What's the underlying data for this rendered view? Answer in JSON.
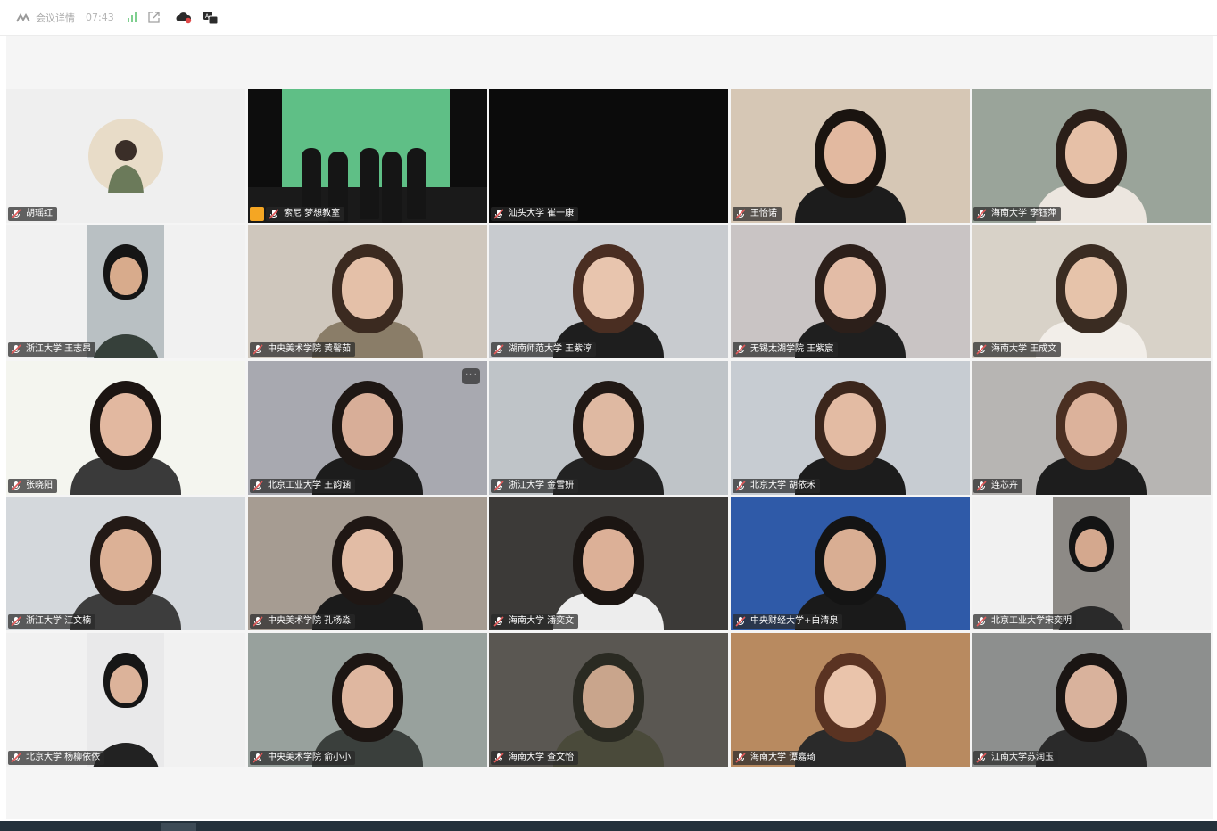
{
  "toolbar": {
    "meeting_details_label": "会议详情",
    "elapsed_time": "07:43",
    "icons": [
      "meeting-logo-icon",
      "signal-bars-icon",
      "external-link-icon",
      "cloud-record-icon",
      "translate-icon"
    ]
  },
  "colors": {
    "name_tag_bg": "#282828",
    "host_badge": "#f5a623",
    "mic_muted": "#e05a5a"
  },
  "participants": [
    {
      "name": "胡瑶红",
      "bg": "#efefef",
      "kind": "avatar"
    },
    {
      "name": "索尼 梦想教室",
      "bg": "#0d0d0d",
      "kind": "stage",
      "host": true
    },
    {
      "name": "汕头大学 崔一康",
      "bg": "#0b0b0b",
      "kind": "dark"
    },
    {
      "name": "王怡诺",
      "bg": "#d6c7b5",
      "kind": "video",
      "hair": "#1a1410",
      "shirt": "#1c1c1c",
      "skin": "#e2b9a0"
    },
    {
      "name": "海南大学 李钰萍",
      "bg": "#9aa49a",
      "kind": "video",
      "hair": "#2a1e18",
      "shirt": "#ece6df",
      "skin": "#e6c0a7"
    },
    {
      "name": "浙江大学 王志昂",
      "bg": "#f1f1f1",
      "kind": "portrait",
      "hair": "#151515",
      "shirt": "#36403a",
      "skin": "#d8ab8c",
      "pbg": "#b9c0c3"
    },
    {
      "name": "中央美术学院 黄馨茹",
      "bg": "#cfc7bd",
      "kind": "video",
      "hair": "#3b2a20",
      "shirt": "#8a7d68",
      "skin": "#e4c0a8"
    },
    {
      "name": "湖南师范大学 王紫淳",
      "bg": "#c8cbcf",
      "kind": "video",
      "hair": "#4a2e22",
      "shirt": "#1e1e1e",
      "skin": "#e8c5ae"
    },
    {
      "name": "无锡太湖学院 王紫宸",
      "bg": "#c9c4c4",
      "kind": "video",
      "hair": "#2c1f1a",
      "shirt": "#1f1f1f",
      "skin": "#e3bca6"
    },
    {
      "name": "海南大学 王成文",
      "bg": "#d8d2c8",
      "kind": "video",
      "hair": "#3a2c22",
      "shirt": "#f2eee9",
      "skin": "#e6c3aa"
    },
    {
      "name": "张晓阳",
      "bg": "#f4f5ef",
      "kind": "video",
      "hair": "#1c1512",
      "shirt": "#3a3a3a",
      "skin": "#e2b8a0"
    },
    {
      "name": "北京工业大学 王韵涵",
      "bg": "#a8a9b0",
      "kind": "video",
      "hair": "#1e1714",
      "shirt": "#1c1c1c",
      "skin": "#d8ae98",
      "more": true
    },
    {
      "name": "浙江大学 金雪妍",
      "bg": "#bfc4c8",
      "kind": "video",
      "hair": "#211915",
      "shirt": "#222222",
      "skin": "#dfb9a2"
    },
    {
      "name": "北京大学 胡依禾",
      "bg": "#c7ccd2",
      "kind": "video",
      "hair": "#3b261c",
      "shirt": "#1c1c1c",
      "skin": "#e3bba3"
    },
    {
      "name": "连芯卉",
      "bg": "#b7b5b3",
      "kind": "video",
      "hair": "#4a2f22",
      "shirt": "#1d1d1d",
      "skin": "#dcb29b"
    },
    {
      "name": "浙江大学 江文楠",
      "bg": "#d4d8dc",
      "kind": "video",
      "hair": "#231a16",
      "shirt": "#3d3d3d",
      "skin": "#dcb196"
    },
    {
      "name": "中央美术学院 孔杨淼",
      "bg": "#a69c92",
      "kind": "video",
      "hair": "#1f1714",
      "shirt": "#1b1b1b",
      "skin": "#e2bca5"
    },
    {
      "name": "海南大学 潘奕文",
      "bg": "#3c3a38",
      "kind": "video",
      "hair": "#1b1512",
      "shirt": "#ededed",
      "skin": "#dcb097"
    },
    {
      "name": "中央财经大学+白清泉",
      "bg": "#2f5aa8",
      "kind": "video",
      "hair": "#141414",
      "shirt": "#1a1a1a",
      "skin": "#d9ae93"
    },
    {
      "name": "北京工业大学宋奕明",
      "bg": "#f1f1f1",
      "kind": "portrait",
      "hair": "#141414",
      "shirt": "#2a2a2a",
      "skin": "#d4a88e",
      "pbg": "#8d8a86"
    },
    {
      "name": "北京大学 杨柳依依",
      "bg": "#f1f1f1",
      "kind": "portrait",
      "hair": "#161616",
      "shirt": "#222222",
      "skin": "#dcb39a",
      "pbg": "#e9e9ea"
    },
    {
      "name": "中央美术学院 俞小小",
      "bg": "#98a19d",
      "kind": "video",
      "hair": "#1d1613",
      "shirt": "#3a3f3c",
      "skin": "#dfb7a0"
    },
    {
      "name": "海南大学 查文怡",
      "bg": "#5a5752",
      "kind": "video",
      "hair": "#2a2a22",
      "shirt": "#4a4a3a",
      "skin": "#c9a58c"
    },
    {
      "name": "海南大学 谭嘉琦",
      "bg": "#b88a60",
      "kind": "video",
      "hair": "#5a3322",
      "shirt": "#2a2a2a",
      "skin": "#eac4ab"
    },
    {
      "name": "江南大学苏润玉",
      "bg": "#8d8f8e",
      "kind": "video",
      "hair": "#1a1513",
      "shirt": "#2a2a2a",
      "skin": "#d9b29c"
    }
  ]
}
